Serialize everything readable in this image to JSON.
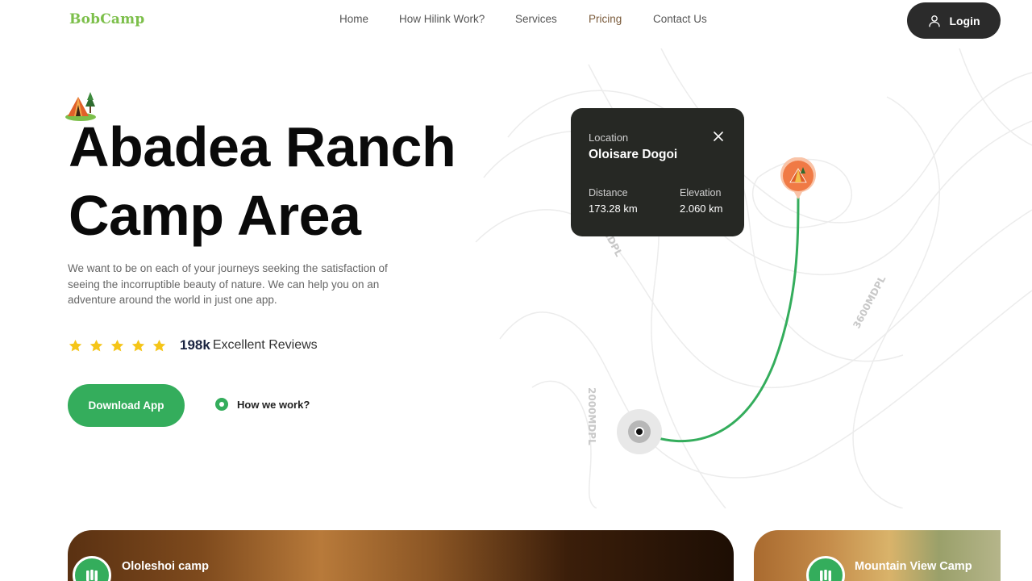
{
  "header": {
    "logo": "BobCamp",
    "nav": [
      {
        "label": "Home"
      },
      {
        "label": "How Hilink Work?"
      },
      {
        "label": "Services"
      },
      {
        "label": "Pricing"
      },
      {
        "label": "Contact Us"
      }
    ],
    "login_label": "Login"
  },
  "hero": {
    "title_line1": "Abadea Ranch",
    "title_line2": "Camp Area",
    "description": "We want to be on each of your journeys seeking the satisfaction of seeing the incorruptible beauty of nature. We can help you on an adventure around the world in just one app.",
    "rating": {
      "stars": 5,
      "count": "198k",
      "label": "Excellent Reviews"
    },
    "download_label": "Download App",
    "how_label": "How we work?"
  },
  "map": {
    "contour_labels": [
      "2000MDPL",
      "3600MDPL",
      "MDPL"
    ],
    "location_label": "Location",
    "location_name": "Oloisare Dogoi",
    "distance_label": "Distance",
    "distance_value": "173.28 km",
    "elevation_label": "Elevation",
    "elevation_value": "2.060 km",
    "route_color": "#34ad5c",
    "pin_color": "#f07a45"
  },
  "camps": [
    {
      "name": "Ololeshoi camp"
    },
    {
      "name": "Mountain View Camp"
    }
  ],
  "colors": {
    "accent": "#34ad5c",
    "logo": "#7cbf4a",
    "dark": "#2b2b2b",
    "star": "#f5c518"
  }
}
